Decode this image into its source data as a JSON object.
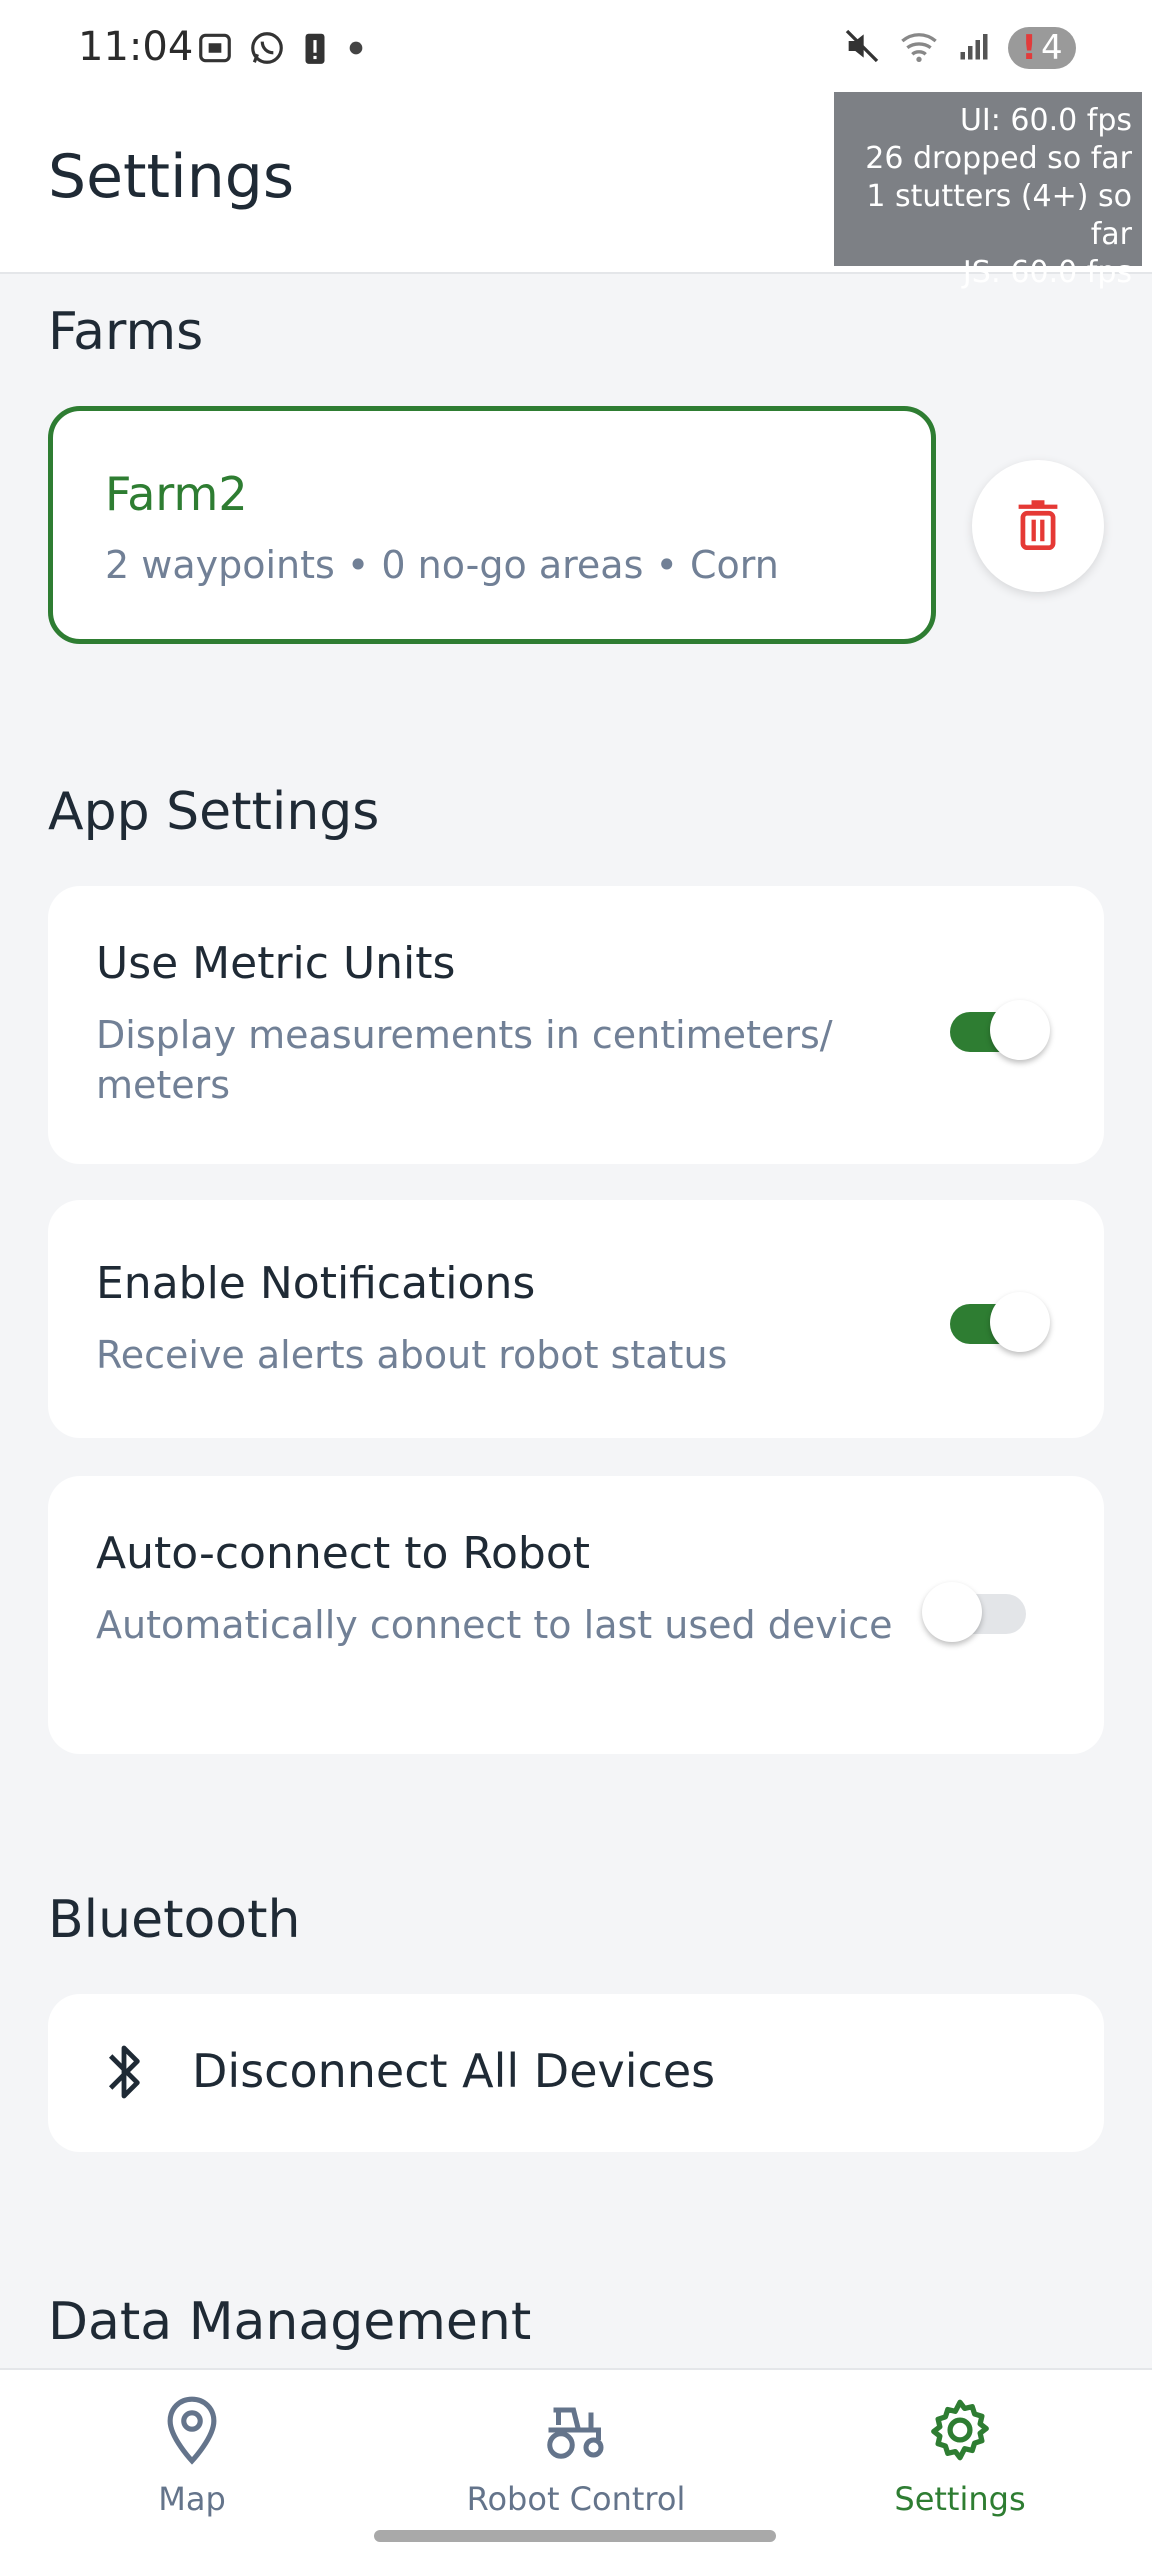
{
  "status_bar": {
    "time": "11:04",
    "notification_count": "4",
    "notification_mark": "!"
  },
  "header": {
    "title": "Settings"
  },
  "perf_overlay": {
    "lines": [
      "UI: 60.0 fps",
      "26 dropped so far",
      "1 stutters (4+) so far",
      "JS: 60.0 fps"
    ]
  },
  "farms": {
    "section_title": "Farms",
    "items": [
      {
        "name": "Farm2",
        "meta": "2 waypoints • 0 no-go areas • Corn"
      }
    ]
  },
  "app_settings": {
    "section_title": "App Settings",
    "items": [
      {
        "title": "Use Metric Units",
        "description": "Display measurements in centimeters/ meters",
        "enabled": true
      },
      {
        "title": "Enable Notifications",
        "description": "Receive alerts about robot status",
        "enabled": true
      },
      {
        "title": "Auto-connect to Robot",
        "description": "Automatically connect to last used device",
        "enabled": false
      }
    ]
  },
  "bluetooth": {
    "section_title": "Bluetooth",
    "disconnect_label": "Disconnect All Devices"
  },
  "data_management": {
    "section_title": "Data Management"
  },
  "bottom_nav": {
    "items": [
      {
        "label": "Map",
        "icon": "map-pin-icon",
        "active": false
      },
      {
        "label": "Robot Control",
        "icon": "tractor-icon",
        "active": false
      },
      {
        "label": "Settings",
        "icon": "gear-icon",
        "active": true
      }
    ]
  },
  "colors": {
    "accent": "#2e7d32",
    "danger": "#e53935",
    "muted_text": "#718096",
    "background": "#f4f5f7"
  }
}
